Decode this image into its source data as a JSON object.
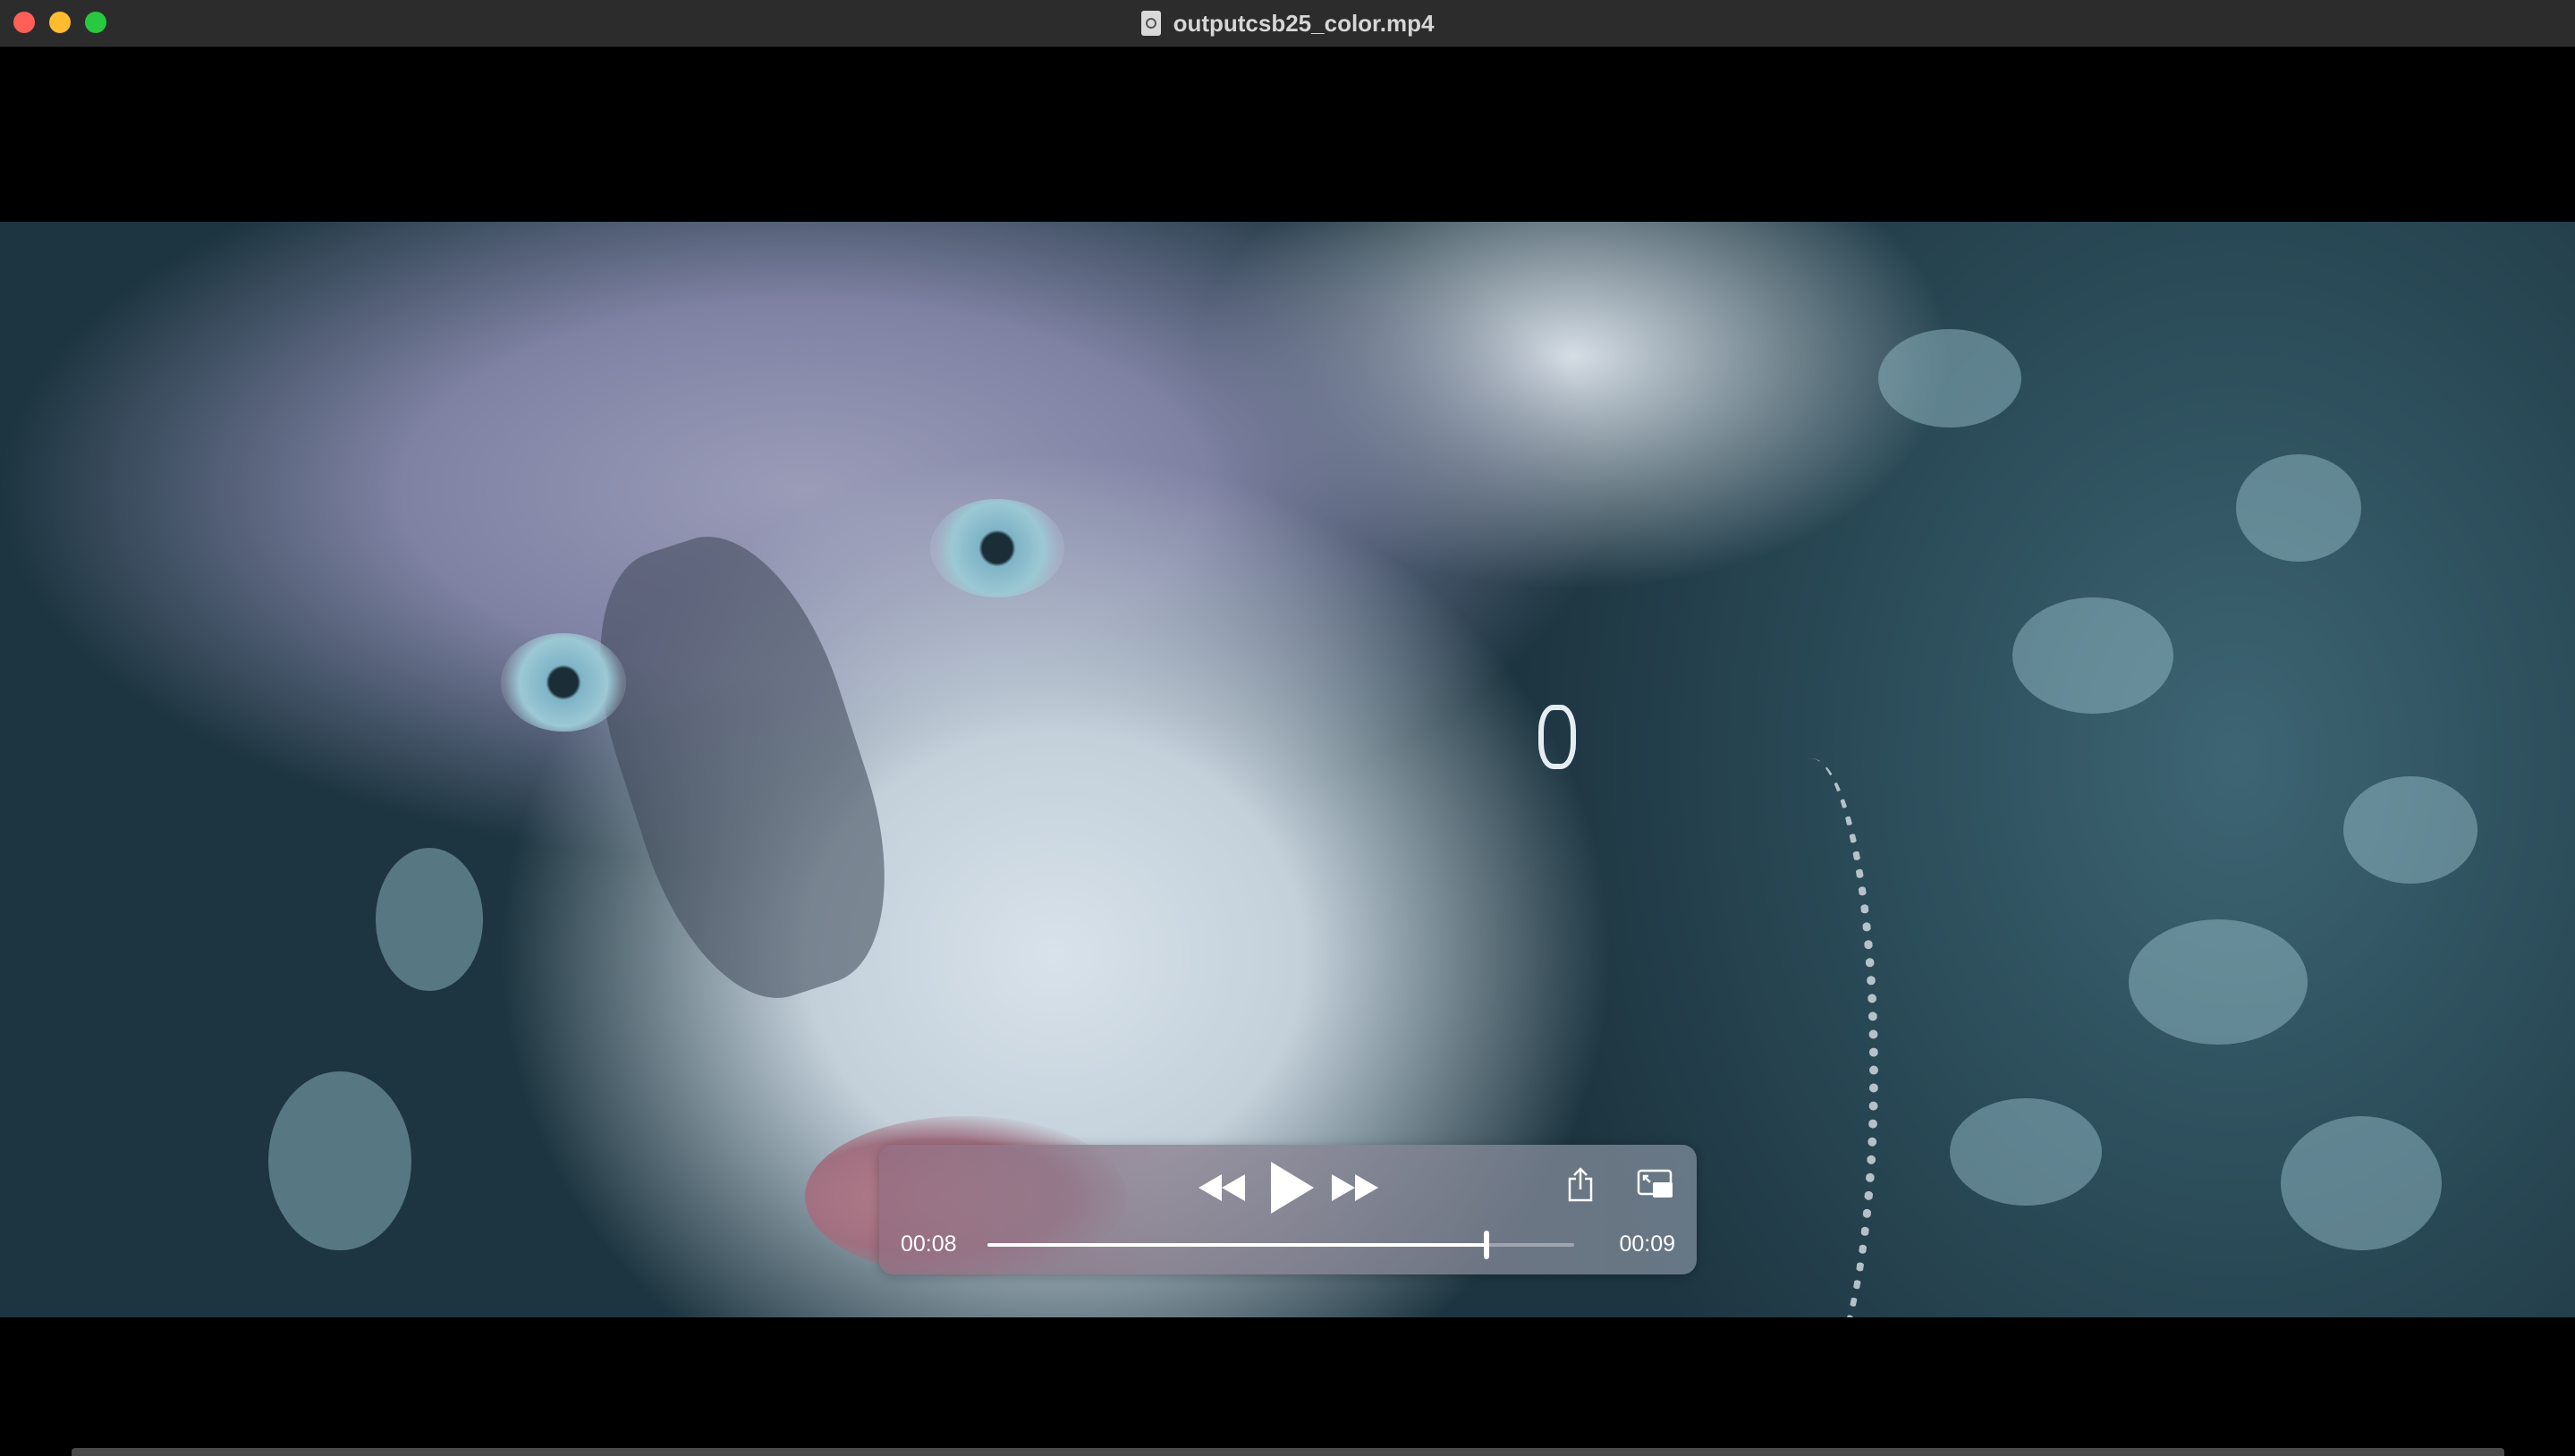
{
  "window": {
    "title": "outputcsb25_color.mp4",
    "traffic_lights": {
      "close_color": "#fe5f57",
      "minimize_color": "#febc2e",
      "maximize_color": "#28c840"
    }
  },
  "player": {
    "elapsed": "00:08",
    "remaining": "00:09",
    "progress_fraction": 0.85,
    "state": "paused",
    "buttons": {
      "rewind_icon": "rewind-icon",
      "play_icon": "play-icon",
      "fast_forward_icon": "fast-forward-icon",
      "share_icon": "share-icon",
      "pip_icon": "picture-in-picture-icon"
    }
  }
}
